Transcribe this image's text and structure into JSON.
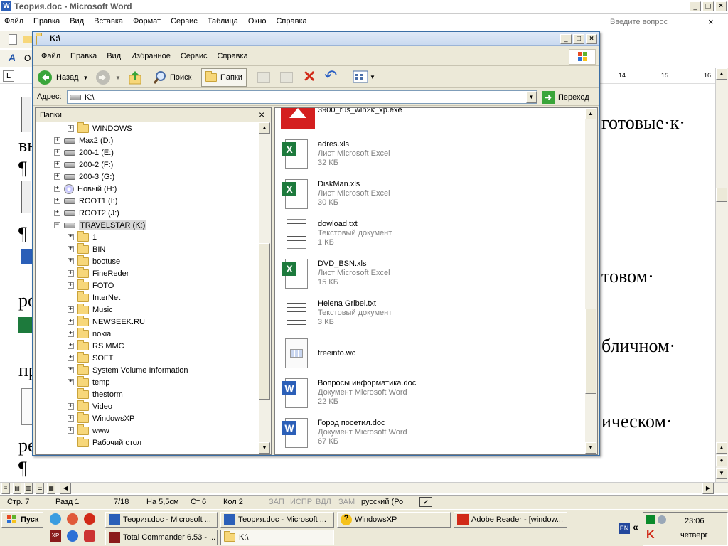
{
  "word": {
    "title": "Теория.doc - Microsoft Word",
    "menu": [
      "Файл",
      "Правка",
      "Вид",
      "Вставка",
      "Формат",
      "Сервис",
      "Таблица",
      "Окно",
      "Справка"
    ],
    "help_placeholder": "Введите вопрос",
    "ruler": [
      "14",
      "15",
      "16"
    ],
    "doc_fragments": [
      "готовые·к·",
      "вы",
      "¶",
      "¶",
      "товом·",
      "ро",
      "бличном·",
      "пр",
      "ическом·",
      "ре",
      "¶"
    ],
    "status": [
      "Стр. 7",
      "Разд 1",
      "7/18",
      "На 5,5см",
      "Ст 6",
      "Кол 2",
      "ЗАП",
      "ИСПР",
      "ВДЛ",
      "ЗАМ",
      "русский (Ро"
    ]
  },
  "explorer": {
    "title": "K:\\",
    "menu": [
      "Файл",
      "Правка",
      "Вид",
      "Избранное",
      "Сервис",
      "Справка"
    ],
    "back_label": "Назад",
    "search_label": "Поиск",
    "folders_label": "Папки",
    "address_label": "Адрес:",
    "address_value": "K:\\",
    "go_label": "Переход",
    "folders_pane_title": "Папки",
    "tree": [
      {
        "label": "WINDOWS",
        "type": "folder",
        "level": 2,
        "exp": true
      },
      {
        "label": "Max2 (D:)",
        "type": "drive",
        "level": 1,
        "exp": true
      },
      {
        "label": "200-1 (E:)",
        "type": "drive",
        "level": 1,
        "exp": true
      },
      {
        "label": "200-2 (F:)",
        "type": "drive",
        "level": 1,
        "exp": true
      },
      {
        "label": "200-3 (G:)",
        "type": "drive",
        "level": 1,
        "exp": true
      },
      {
        "label": "Новый (H:)",
        "type": "cd",
        "level": 1,
        "exp": true
      },
      {
        "label": "ROOT1 (I:)",
        "type": "drive",
        "level": 1,
        "exp": true
      },
      {
        "label": "ROOT2 (J:)",
        "type": "drive",
        "level": 1,
        "exp": true
      },
      {
        "label": "TRAVELSTAR (K:)",
        "type": "drive",
        "level": 1,
        "exp": "open",
        "selected": true
      },
      {
        "label": "1",
        "type": "folder",
        "level": 2,
        "exp": true
      },
      {
        "label": "BIN",
        "type": "folder",
        "level": 2,
        "exp": true
      },
      {
        "label": "bootuse",
        "type": "folder",
        "level": 2,
        "exp": true
      },
      {
        "label": "FineReder",
        "type": "folder",
        "level": 2,
        "exp": true
      },
      {
        "label": "FOTO",
        "type": "folder",
        "level": 2,
        "exp": true
      },
      {
        "label": "InterNet",
        "type": "folder",
        "level": 2,
        "exp": false
      },
      {
        "label": "Music",
        "type": "folder",
        "level": 2,
        "exp": true
      },
      {
        "label": "NEWSEEK.RU",
        "type": "folder",
        "level": 2,
        "exp": true
      },
      {
        "label": "nokia",
        "type": "folder",
        "level": 2,
        "exp": true
      },
      {
        "label": "RS MMC",
        "type": "folder",
        "level": 2,
        "exp": true
      },
      {
        "label": "SOFT",
        "type": "folder",
        "level": 2,
        "exp": true
      },
      {
        "label": "System Volume Information",
        "type": "folder",
        "level": 2,
        "exp": true
      },
      {
        "label": "temp",
        "type": "folder",
        "level": 2,
        "exp": true
      },
      {
        "label": "thestorm",
        "type": "folder",
        "level": 2,
        "exp": false
      },
      {
        "label": "Video",
        "type": "folder",
        "level": 2,
        "exp": true
      },
      {
        "label": "WindowsXP",
        "type": "folder",
        "level": 2,
        "exp": true
      },
      {
        "label": "www",
        "type": "folder",
        "level": 2,
        "exp": true
      },
      {
        "label": "Рабочий стол",
        "type": "folder",
        "level": 2,
        "exp": false
      }
    ],
    "files": [
      {
        "name": "3900_rus_win2k_xp.exe",
        "type": "",
        "size": "",
        "kind": "exe"
      },
      {
        "name": "adres.xls",
        "type": "Лист Microsoft Excel",
        "size": "32 КБ",
        "kind": "xls"
      },
      {
        "name": "DiskMan.xls",
        "type": "Лист Microsoft Excel",
        "size": "30 КБ",
        "kind": "xls"
      },
      {
        "name": "dowload.txt",
        "type": "Текстовый документ",
        "size": "1 КБ",
        "kind": "txt"
      },
      {
        "name": "DVD_BSN.xls",
        "type": "Лист Microsoft Excel",
        "size": "15 КБ",
        "kind": "xls"
      },
      {
        "name": "Helena Gribel.txt",
        "type": "Текстовый документ",
        "size": "3 КБ",
        "kind": "txt"
      },
      {
        "name": "treeinfo.wc",
        "type": "",
        "size": "",
        "kind": "wc"
      },
      {
        "name": "Вопросы информатика.doc",
        "type": "Документ Microsoft Word",
        "size": "22 КБ",
        "kind": "doc"
      },
      {
        "name": "Город посетил.doc",
        "type": "Документ Microsoft Word",
        "size": "67 КБ",
        "kind": "doc"
      }
    ]
  },
  "taskbar": {
    "start_label": "Пуск",
    "tasks_row1": [
      "Теория.doc - Microsoft ...",
      "Теория.doc - Microsoft ...",
      "WindowsXP",
      "Adobe Reader - [window..."
    ],
    "tasks_row2": [
      "Total Commander 6.53 - ...",
      "K:\\"
    ],
    "lang": "EN",
    "time": "23:06",
    "day": "четверг"
  }
}
